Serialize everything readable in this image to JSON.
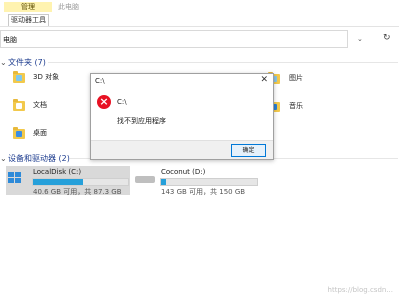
{
  "ribbon": {
    "context_tab": "管理",
    "context_sub": "驱动器工具",
    "plain_tab": "此电脑"
  },
  "address": {
    "text": "电脑",
    "chevron": "⌄",
    "refresh": "↻"
  },
  "sections": {
    "folders": "文件夹 (7)",
    "devices": "设备和驱动器 (2)"
  },
  "folders": [
    {
      "label": "3D 对象"
    },
    {
      "label": "文档"
    },
    {
      "label": "桌面"
    },
    {
      "label": "图片"
    },
    {
      "label": "音乐"
    }
  ],
  "drives": [
    {
      "name": "LocalDisk (C:)",
      "detail": "40.6 GB 可用，共 87.3 GB",
      "used_fraction": 0.53
    },
    {
      "name": "Coconut (D:)",
      "detail": "143 GB 可用，共 150 GB",
      "used_fraction": 0.05
    }
  ],
  "dialog": {
    "title": "C:\\",
    "close": "✕",
    "error_glyph": "×",
    "path": "C:\\",
    "message": "找不到应用程序",
    "ok": "确定"
  },
  "watermark": "https://blog.csdn..."
}
